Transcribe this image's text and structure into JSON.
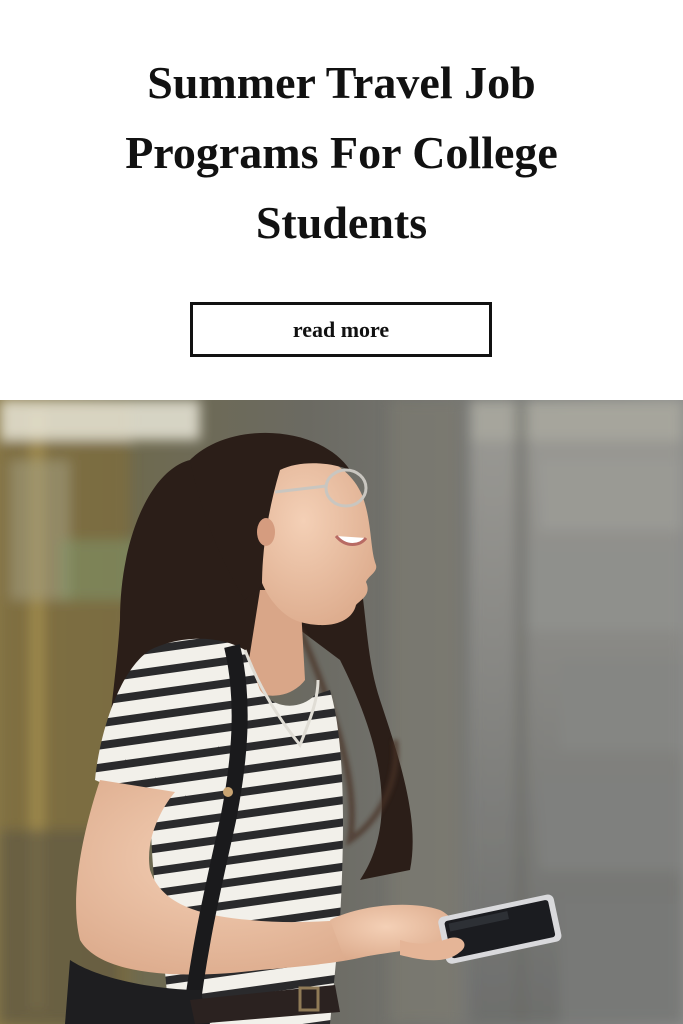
{
  "header": {
    "title": "Summer Travel Job Programs For College Students"
  },
  "cta": {
    "read_more_label": "read more"
  },
  "photo": {
    "subject": "smiling-student-with-tablet"
  },
  "colors": {
    "background": "#ffffff",
    "text": "#111111",
    "button_border": "#111111"
  }
}
